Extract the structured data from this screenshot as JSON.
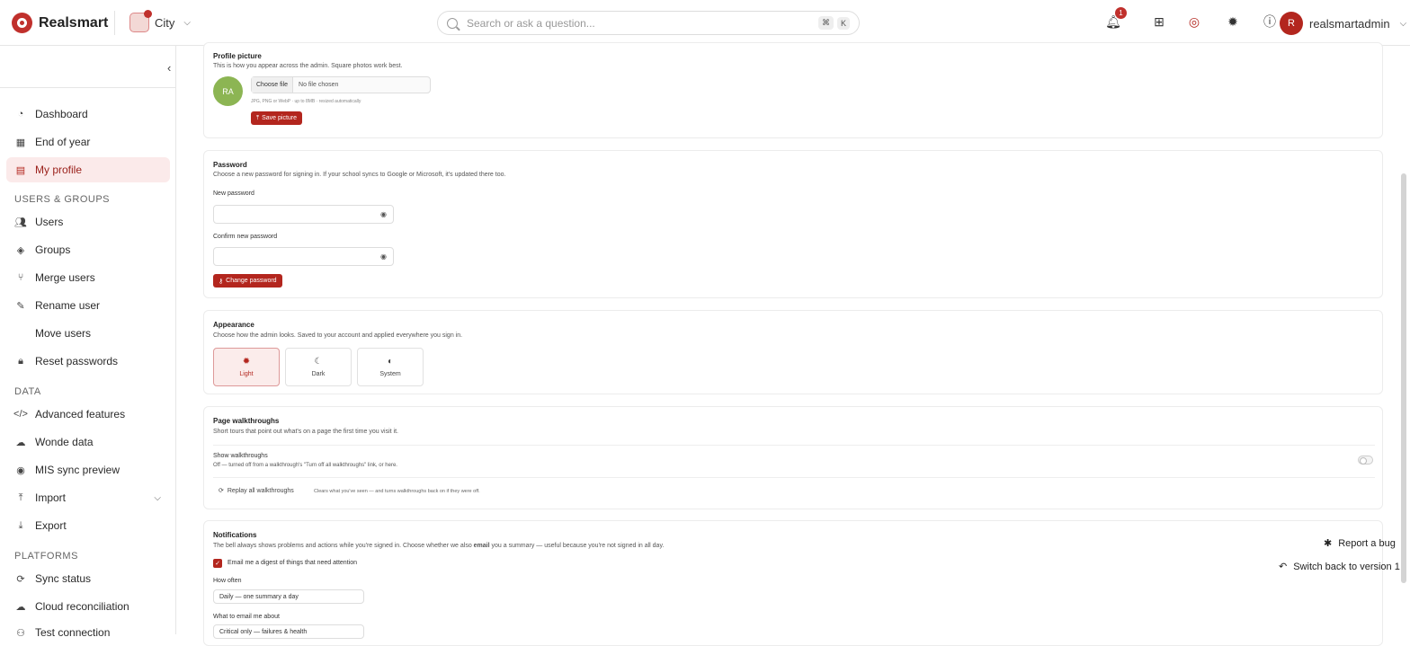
{
  "brand": {
    "name": "Realsmart"
  },
  "school": {
    "name": "City"
  },
  "search": {
    "placeholder": "Search or ask a question...",
    "shortcut_mod": "⌘",
    "shortcut_key": "K"
  },
  "notifications": {
    "count": "1"
  },
  "user": {
    "initial": "R",
    "name": "realsmartadmin"
  },
  "sidebar": {
    "items_top": [
      {
        "label": "Dashboard",
        "icon": "dashboard-icon"
      },
      {
        "label": "End of year",
        "icon": "calendar-icon"
      },
      {
        "label": "My profile",
        "icon": "id-card-icon",
        "active": true
      }
    ],
    "section_users": "USERS & GROUPS",
    "items_users": [
      {
        "label": "Users",
        "icon": "users-icon"
      },
      {
        "label": "Groups",
        "icon": "layers-icon"
      },
      {
        "label": "Merge users",
        "icon": "merge-icon"
      },
      {
        "label": "Rename user",
        "icon": "rename-icon"
      },
      {
        "label": "Move users",
        "icon": ""
      },
      {
        "label": "Reset passwords",
        "icon": "lock-icon"
      }
    ],
    "section_data": "DATA",
    "items_data": [
      {
        "label": "Advanced features",
        "icon": "code-icon"
      },
      {
        "label": "Wonde data",
        "icon": "cloud-download-icon"
      },
      {
        "label": "MIS sync preview",
        "icon": "eye-icon"
      },
      {
        "label": "Import",
        "icon": "upload-icon"
      },
      {
        "label": "Export",
        "icon": "download-icon"
      }
    ],
    "section_platforms": "PLATFORMS",
    "items_platforms": [
      {
        "label": "Sync status",
        "icon": "sync-icon"
      },
      {
        "label": "Cloud reconciliation",
        "icon": "cloud-icon"
      },
      {
        "label": "Test connection",
        "icon": "plug-icon"
      }
    ]
  },
  "profile_picture": {
    "title": "Profile picture",
    "desc": "This is how you appear across the admin. Square photos work best.",
    "initials": "RA",
    "choose_label": "Choose file",
    "no_file": "No file chosen",
    "hint": "JPG, PNG or WebP · up to 8MB · resized automatically",
    "save_label": "Save picture"
  },
  "password": {
    "title": "Password",
    "desc": "Choose a new password for signing in. If your school syncs to Google or Microsoft, it's updated there too.",
    "new_label": "New password",
    "confirm_label": "Confirm new password",
    "change_label": "Change password"
  },
  "appearance": {
    "title": "Appearance",
    "desc": "Choose how the admin looks. Saved to your account and applied everywhere you sign in.",
    "options": [
      {
        "label": "Light",
        "glyph": "✹"
      },
      {
        "label": "Dark",
        "glyph": "☾"
      },
      {
        "label": "System",
        "glyph": "◐"
      }
    ],
    "selected": "Light"
  },
  "walkthroughs": {
    "title": "Page walkthroughs",
    "desc": "Short tours that point out what's on a page the first time you visit it.",
    "show_label": "Show walkthroughs",
    "show_desc": "Off — turned off from a walkthrough's \"Turn off all walkthroughs\" link, or here.",
    "enabled": false,
    "replay_label": "Replay all walkthroughs",
    "replay_desc": "Clears what you've seen — and turns walkthroughs back on if they were off."
  },
  "notifications_card": {
    "title": "Notifications",
    "desc_pre": "The bell always shows problems and actions while you're signed in. Choose whether we also ",
    "desc_bold": "email",
    "desc_post": " you a summary — useful because you're not signed in all day.",
    "digest_label": "Email me a digest of things that need attention",
    "digest_checked": true,
    "how_often_label": "How often",
    "how_often_value": "Daily — one summary a day",
    "what_label": "What to email me about",
    "what_value": "Critical only — failures & health"
  },
  "floating": {
    "report_bug": "Report a bug",
    "switch_back": "Switch back to version 1"
  },
  "colors": {
    "accent": "#b3261e",
    "active_bg": "#fbeaea",
    "avatar_green": "#8cb553"
  }
}
